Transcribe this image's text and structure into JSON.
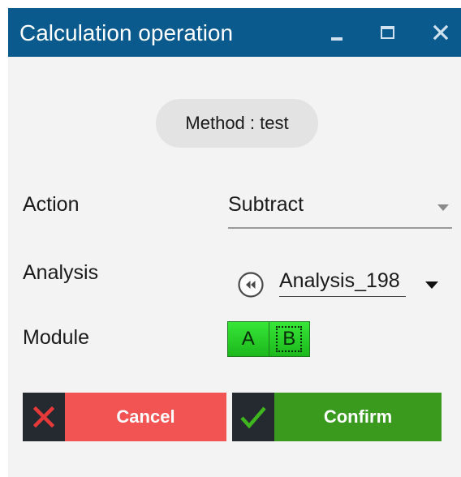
{
  "window": {
    "title": "Calculation operation",
    "controls": [
      "minimize-icon",
      "maximize-icon",
      "close-icon"
    ]
  },
  "method": {
    "text": "Method : test"
  },
  "fields": {
    "action": {
      "label": "Action",
      "value": "Subtract"
    },
    "analysis": {
      "label": "Analysis",
      "value": "Analysis_198"
    },
    "module": {
      "label": "Module",
      "options": [
        "A",
        "B"
      ],
      "focused": "B"
    }
  },
  "buttons": {
    "cancel": {
      "label": "Cancel",
      "icon": "x-icon"
    },
    "confirm": {
      "label": "Confirm",
      "icon": "checkmark-icon"
    }
  },
  "colors": {
    "titlebar": "#0a5a8e",
    "cancel": "#f25353",
    "confirm": "#3a9a1e",
    "icon_box": "#252a31",
    "module_green": "#2bd02b"
  }
}
